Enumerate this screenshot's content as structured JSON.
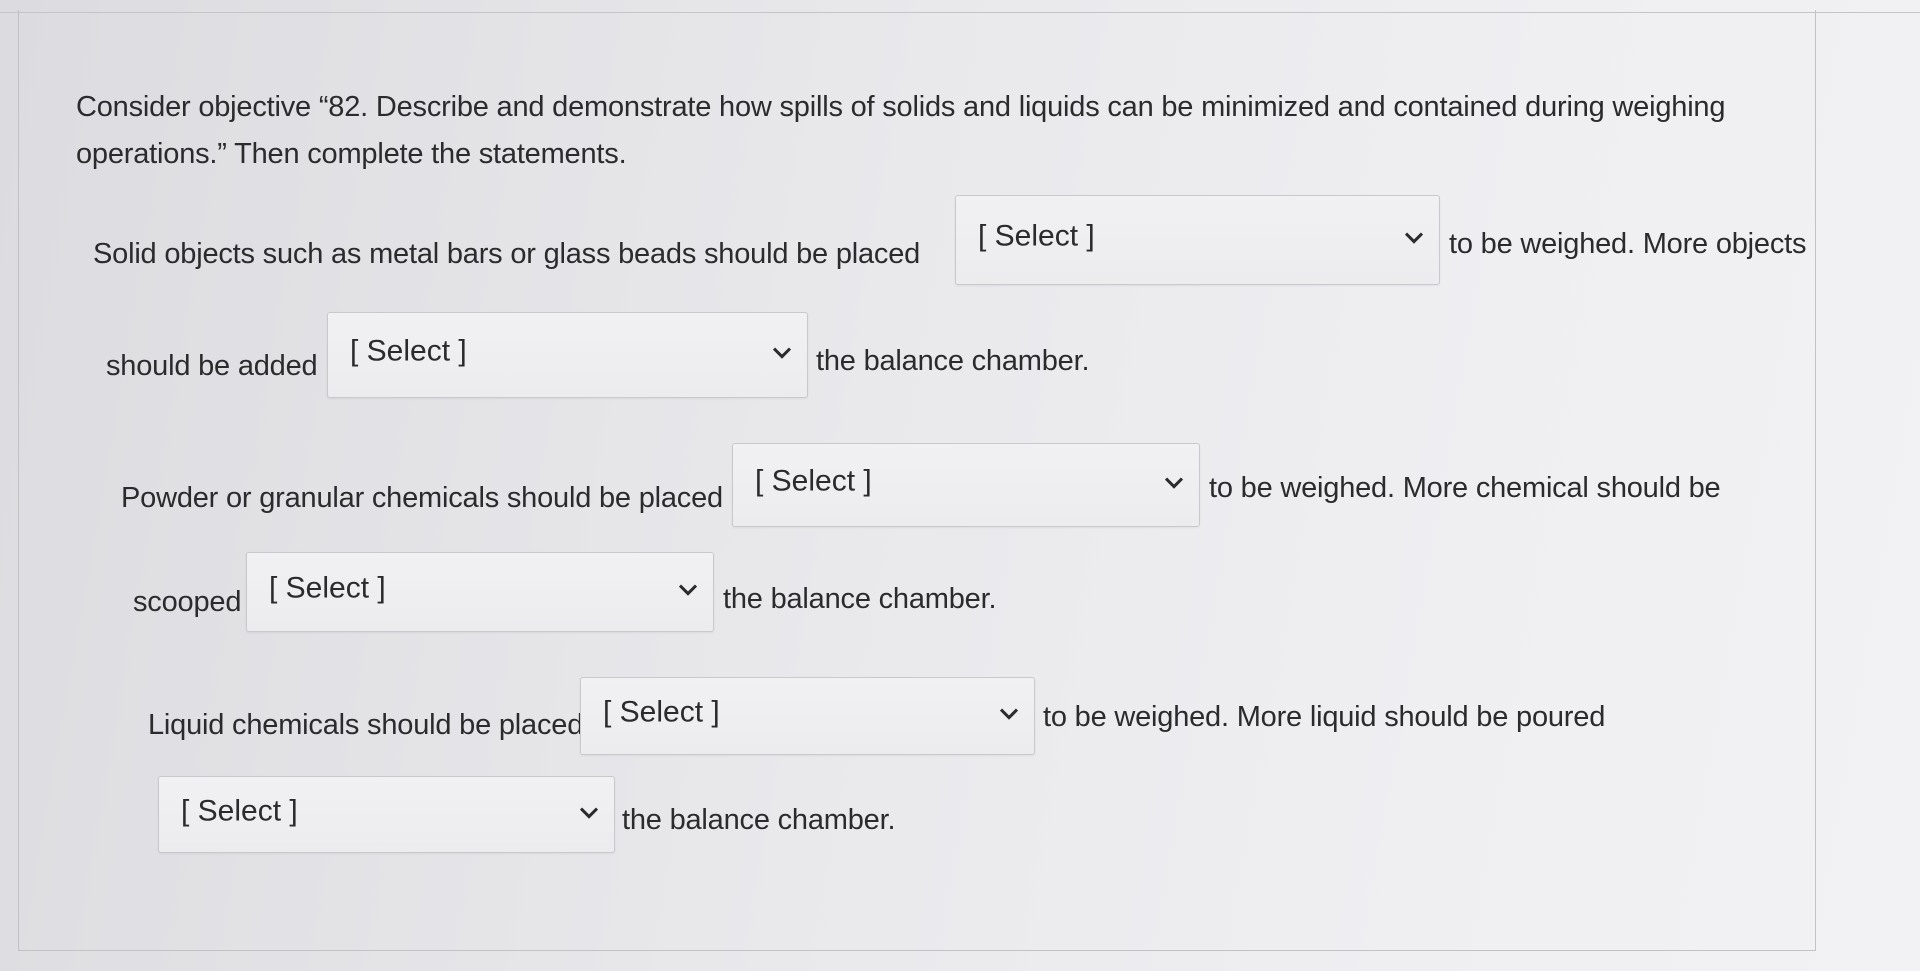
{
  "question": {
    "prompt": "Consider objective “82. Describe and demonstrate how spills of solids and liquids can be minimized and contained during weighing operations.” Then complete the statements."
  },
  "statements": [
    {
      "before": "Solid objects such as metal bars or glass beads should be placed",
      "select": "[ Select ]",
      "after": "to be weighed. More objects"
    },
    {
      "before": "should be added",
      "select": "[ Select ]",
      "after": "the balance chamber."
    },
    {
      "before": "Powder or granular chemicals should be placed",
      "select": "[ Select ]",
      "after": "to be weighed. More chemical should be"
    },
    {
      "before": "scooped",
      "select": "[ Select ]",
      "after": "the balance chamber."
    },
    {
      "before": "Liquid chemicals should be placed",
      "select": "[ Select ]",
      "after": "to be weighed. More liquid should be poured"
    },
    {
      "before": "",
      "select": "[ Select ]",
      "after": "the balance chamber."
    }
  ],
  "icons": {
    "dropdown": "chevron-down-icon"
  }
}
